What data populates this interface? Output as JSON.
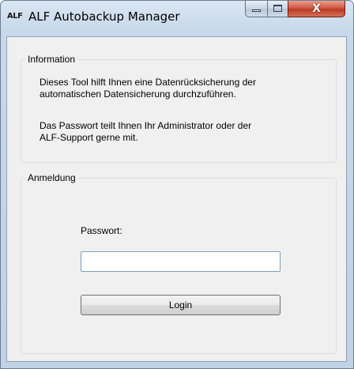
{
  "window": {
    "app_icon_text": "ALF",
    "title": "ALF Autobackup Manager",
    "close_glyph": "X"
  },
  "information": {
    "label": "Information",
    "text1_line1": "Dieses Tool hilft Ihnen eine Datenrücksicherung der",
    "text1_line2": "automatischen Datensicherung durchzuführen.",
    "text2_line1": "Das Passwort teilt Ihnen Ihr Administrator oder der",
    "text2_line2": "ALF-Support gerne mit."
  },
  "login": {
    "label": "Anmeldung",
    "password_label": "Passwort:",
    "password_value": "",
    "button_label": "Login"
  },
  "colors": {
    "close_button": "#c9442f",
    "client_background": "#f0f0f0"
  }
}
